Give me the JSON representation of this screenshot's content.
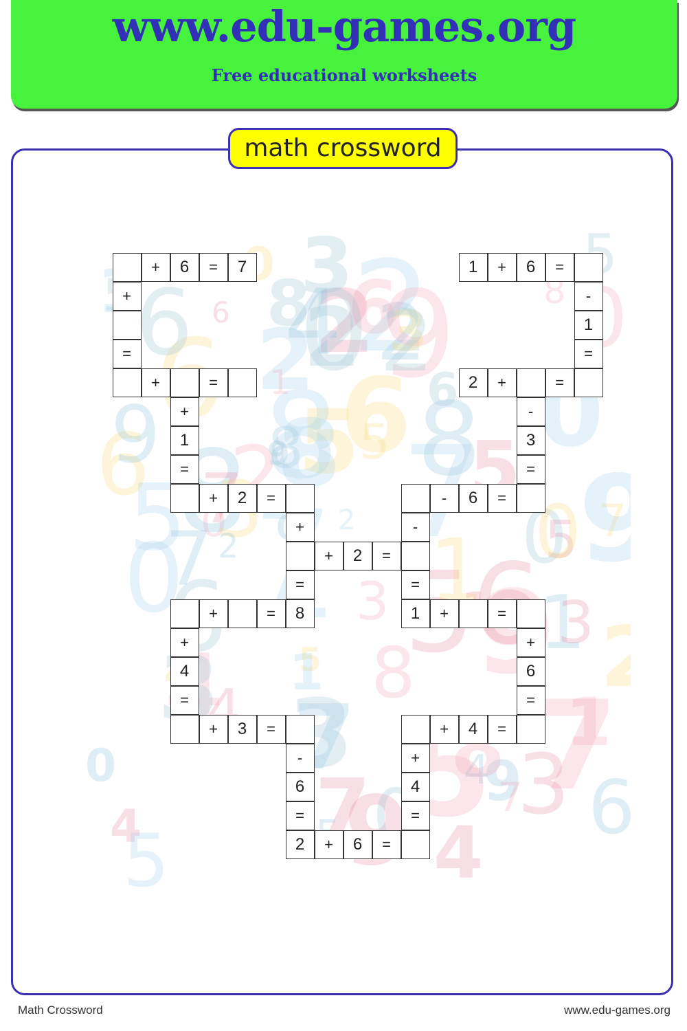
{
  "header": {
    "site_title": "www.edu-games.org",
    "subtitle": "Free educational worksheets",
    "brand_color": "#47f23c",
    "text_color": "#3330b8"
  },
  "worksheet": {
    "title": "math crossword",
    "title_bg_color": "#ffff00",
    "frame_color": "#3a2fae"
  },
  "crossword": {
    "cells": [
      {
        "r": 0,
        "c": 0,
        "v": ""
      },
      {
        "r": 0,
        "c": 1,
        "v": "+"
      },
      {
        "r": 0,
        "c": 2,
        "v": "6"
      },
      {
        "r": 0,
        "c": 3,
        "v": "="
      },
      {
        "r": 0,
        "c": 4,
        "v": "7"
      },
      {
        "r": 0,
        "c": 12,
        "v": "1"
      },
      {
        "r": 0,
        "c": 13,
        "v": "+"
      },
      {
        "r": 0,
        "c": 14,
        "v": "6"
      },
      {
        "r": 0,
        "c": 15,
        "v": "="
      },
      {
        "r": 0,
        "c": 16,
        "v": ""
      },
      {
        "r": 1,
        "c": 0,
        "v": "+"
      },
      {
        "r": 1,
        "c": 16,
        "v": "-"
      },
      {
        "r": 2,
        "c": 0,
        "v": ""
      },
      {
        "r": 2,
        "c": 16,
        "v": "1"
      },
      {
        "r": 3,
        "c": 0,
        "v": "="
      },
      {
        "r": 3,
        "c": 16,
        "v": "="
      },
      {
        "r": 4,
        "c": 0,
        "v": ""
      },
      {
        "r": 4,
        "c": 1,
        "v": "+"
      },
      {
        "r": 4,
        "c": 2,
        "v": ""
      },
      {
        "r": 4,
        "c": 3,
        "v": "="
      },
      {
        "r": 4,
        "c": 4,
        "v": ""
      },
      {
        "r": 4,
        "c": 12,
        "v": "2"
      },
      {
        "r": 4,
        "c": 13,
        "v": "+"
      },
      {
        "r": 4,
        "c": 14,
        "v": ""
      },
      {
        "r": 4,
        "c": 15,
        "v": "="
      },
      {
        "r": 4,
        "c": 16,
        "v": ""
      },
      {
        "r": 5,
        "c": 2,
        "v": "+"
      },
      {
        "r": 5,
        "c": 14,
        "v": "-"
      },
      {
        "r": 6,
        "c": 2,
        "v": "1"
      },
      {
        "r": 6,
        "c": 14,
        "v": "3"
      },
      {
        "r": 7,
        "c": 2,
        "v": "="
      },
      {
        "r": 7,
        "c": 14,
        "v": "="
      },
      {
        "r": 8,
        "c": 2,
        "v": ""
      },
      {
        "r": 8,
        "c": 3,
        "v": "+"
      },
      {
        "r": 8,
        "c": 4,
        "v": "2"
      },
      {
        "r": 8,
        "c": 5,
        "v": "="
      },
      {
        "r": 8,
        "c": 6,
        "v": ""
      },
      {
        "r": 8,
        "c": 10,
        "v": ""
      },
      {
        "r": 8,
        "c": 11,
        "v": "-"
      },
      {
        "r": 8,
        "c": 12,
        "v": "6"
      },
      {
        "r": 8,
        "c": 13,
        "v": "="
      },
      {
        "r": 8,
        "c": 14,
        "v": ""
      },
      {
        "r": 9,
        "c": 6,
        "v": "+"
      },
      {
        "r": 9,
        "c": 10,
        "v": "-"
      },
      {
        "r": 10,
        "c": 6,
        "v": ""
      },
      {
        "r": 10,
        "c": 7,
        "v": "+"
      },
      {
        "r": 10,
        "c": 8,
        "v": "2"
      },
      {
        "r": 10,
        "c": 9,
        "v": "="
      },
      {
        "r": 10,
        "c": 10,
        "v": ""
      },
      {
        "r": 11,
        "c": 6,
        "v": "="
      },
      {
        "r": 11,
        "c": 10,
        "v": "="
      },
      {
        "r": 12,
        "c": 2,
        "v": ""
      },
      {
        "r": 12,
        "c": 3,
        "v": "+"
      },
      {
        "r": 12,
        "c": 4,
        "v": ""
      },
      {
        "r": 12,
        "c": 5,
        "v": "="
      },
      {
        "r": 12,
        "c": 6,
        "v": "8"
      },
      {
        "r": 12,
        "c": 10,
        "v": "1"
      },
      {
        "r": 12,
        "c": 11,
        "v": "+"
      },
      {
        "r": 12,
        "c": 12,
        "v": ""
      },
      {
        "r": 12,
        "c": 13,
        "v": "="
      },
      {
        "r": 12,
        "c": 14,
        "v": ""
      },
      {
        "r": 13,
        "c": 2,
        "v": "+"
      },
      {
        "r": 13,
        "c": 14,
        "v": "+"
      },
      {
        "r": 14,
        "c": 2,
        "v": "4"
      },
      {
        "r": 14,
        "c": 14,
        "v": "6"
      },
      {
        "r": 15,
        "c": 2,
        "v": "="
      },
      {
        "r": 15,
        "c": 14,
        "v": "="
      },
      {
        "r": 16,
        "c": 2,
        "v": ""
      },
      {
        "r": 16,
        "c": 3,
        "v": "+"
      },
      {
        "r": 16,
        "c": 4,
        "v": "3"
      },
      {
        "r": 16,
        "c": 5,
        "v": "="
      },
      {
        "r": 16,
        "c": 6,
        "v": ""
      },
      {
        "r": 16,
        "c": 10,
        "v": ""
      },
      {
        "r": 16,
        "c": 11,
        "v": "+"
      },
      {
        "r": 16,
        "c": 12,
        "v": "4"
      },
      {
        "r": 16,
        "c": 13,
        "v": "="
      },
      {
        "r": 16,
        "c": 14,
        "v": ""
      },
      {
        "r": 17,
        "c": 6,
        "v": "-"
      },
      {
        "r": 17,
        "c": 10,
        "v": "+"
      },
      {
        "r": 18,
        "c": 6,
        "v": "6"
      },
      {
        "r": 18,
        "c": 10,
        "v": "4"
      },
      {
        "r": 19,
        "c": 6,
        "v": "="
      },
      {
        "r": 19,
        "c": 10,
        "v": "="
      },
      {
        "r": 20,
        "c": 6,
        "v": "2"
      },
      {
        "r": 20,
        "c": 7,
        "v": "+"
      },
      {
        "r": 20,
        "c": 8,
        "v": "6"
      },
      {
        "r": 20,
        "c": 9,
        "v": "="
      },
      {
        "r": 20,
        "c": 10,
        "v": ""
      }
    ]
  },
  "background_digits": [
    "2",
    "6",
    "5",
    "0",
    "6",
    "4",
    "5",
    "8",
    "7",
    "2",
    "8",
    "5",
    "7",
    "0",
    "5",
    "7",
    "0",
    "4",
    "9",
    "7",
    "6",
    "1",
    "5",
    "2",
    "1",
    "7",
    "4",
    "0",
    "5",
    "3",
    "9",
    "1",
    "6",
    "5",
    "3",
    "5",
    "8",
    "8",
    "0",
    "1",
    "2",
    "9",
    "6",
    "8",
    "2",
    "5",
    "3",
    "7",
    "0",
    "4",
    "5",
    "2",
    "6",
    "3",
    "8",
    "9",
    "3",
    "1",
    "0",
    "7",
    "4",
    "2",
    "6",
    "9",
    "0",
    "1",
    "8",
    "5",
    "3",
    "7",
    "2",
    "6",
    "4",
    "1",
    "0",
    "8",
    "9",
    "5",
    "7",
    "3",
    "1",
    "2",
    "6",
    "4",
    "0",
    "9",
    "5",
    "8",
    "3",
    "6",
    "2",
    "0"
  ],
  "background_palette": [
    "#8fc1dc",
    "#f4a8b8",
    "#f6dc7a",
    "#a9d3ea",
    "#9cc6d6",
    "#e98ca4"
  ],
  "footer": {
    "left": "Math Crossword",
    "right": "www.edu-games.org"
  }
}
